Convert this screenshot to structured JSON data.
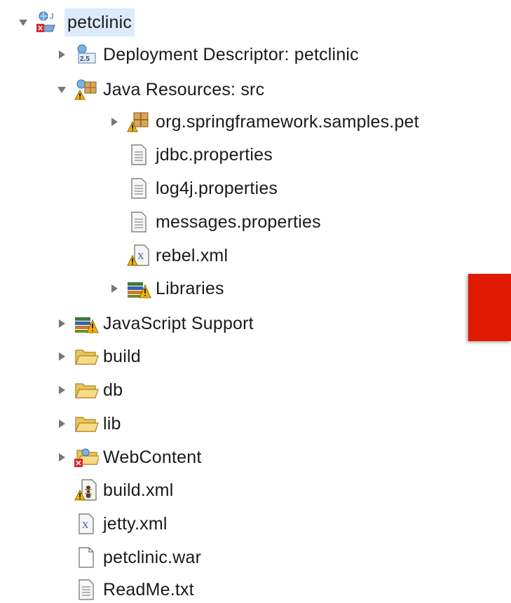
{
  "tree": {
    "root": {
      "label": "petclinic",
      "icon": "web-project-icon",
      "expanded": true,
      "selected": true
    },
    "items": [
      {
        "label": "Deployment Descriptor: petclinic",
        "icon": "deployment-descriptor-icon",
        "expandable": true,
        "expanded": false
      },
      {
        "label": "Java Resources: src",
        "icon": "java-resources-icon",
        "expandable": true,
        "expanded": true
      },
      {
        "label": "org.springframework.samples.pet",
        "icon": "package-icon",
        "expandable": true,
        "expanded": false
      },
      {
        "label": "jdbc.properties",
        "icon": "text-file-icon",
        "expandable": false
      },
      {
        "label": "log4j.properties",
        "icon": "text-file-icon",
        "expandable": false
      },
      {
        "label": "messages.properties",
        "icon": "text-file-icon",
        "expandable": false
      },
      {
        "label": "rebel.xml",
        "icon": "xml-file-warning-icon",
        "expandable": false
      },
      {
        "label": "Libraries",
        "icon": "libraries-icon",
        "expandable": true,
        "expanded": false
      },
      {
        "label": "JavaScript Support",
        "icon": "libraries-icon",
        "expandable": true,
        "expanded": false
      },
      {
        "label": "build",
        "icon": "folder-icon",
        "expandable": true,
        "expanded": false
      },
      {
        "label": "db",
        "icon": "folder-icon",
        "expandable": true,
        "expanded": false
      },
      {
        "label": "lib",
        "icon": "folder-icon",
        "expandable": true,
        "expanded": false
      },
      {
        "label": "WebContent",
        "icon": "web-folder-error-icon",
        "expandable": true,
        "expanded": false
      },
      {
        "label": "build.xml",
        "icon": "ant-file-icon",
        "expandable": false
      },
      {
        "label": "jetty.xml",
        "icon": "xml-file-icon",
        "expandable": false
      },
      {
        "label": "petclinic.war",
        "icon": "blank-file-icon",
        "expandable": false
      },
      {
        "label": "ReadMe.txt",
        "icon": "text-file-icon",
        "expandable": false
      }
    ]
  },
  "colors": {
    "selection": "#dcebfc",
    "overlay": "#e01a00",
    "folder": "#f3cf60",
    "error": "#d9292b",
    "warning": "#f0b400"
  }
}
